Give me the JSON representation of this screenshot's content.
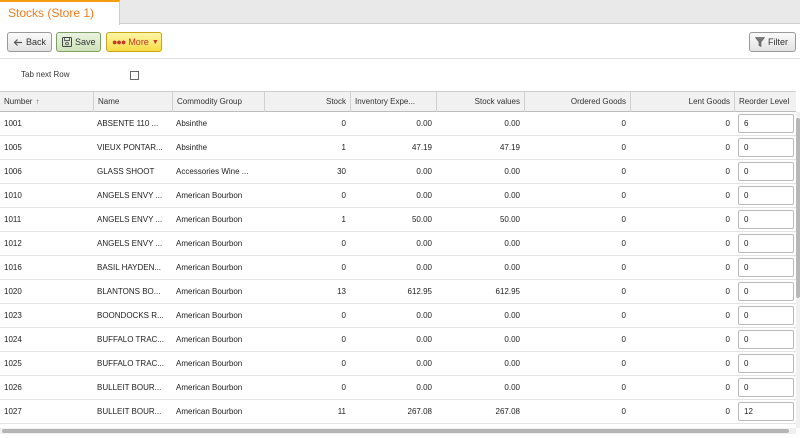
{
  "tab": {
    "title": "Stocks (Store 1)"
  },
  "toolbar": {
    "back_label": "Back",
    "save_label": "Save",
    "more_label": "More",
    "filter_label": "Filter"
  },
  "options": {
    "tab_next_row_label": "Tab next Row",
    "tab_next_row_checked": false
  },
  "table": {
    "columns": [
      "Number",
      "Name",
      "Commodity Group",
      "Stock",
      "Inventory Expe...",
      "Stock values",
      "Ordered Goods",
      "Lent Goods",
      "Reorder Level"
    ],
    "sorted_column": "Number",
    "rows": [
      {
        "number": "1001",
        "name": "ABSENTE 110 ...",
        "group": "Absinthe",
        "stock": "0",
        "inv": "0.00",
        "value": "0.00",
        "ordered": "0",
        "lent": "0",
        "reorder": "6"
      },
      {
        "number": "1005",
        "name": "VIEUX PONTAR...",
        "group": "Absinthe",
        "stock": "1",
        "inv": "47.19",
        "value": "47.19",
        "ordered": "0",
        "lent": "0",
        "reorder": "0"
      },
      {
        "number": "1006",
        "name": "GLASS SHOOT",
        "group": "Accessories Wine ...",
        "stock": "30",
        "inv": "0.00",
        "value": "0.00",
        "ordered": "0",
        "lent": "0",
        "reorder": "0"
      },
      {
        "number": "1010",
        "name": "ANGELS ENVY ...",
        "group": "American Bourbon",
        "stock": "0",
        "inv": "0.00",
        "value": "0.00",
        "ordered": "0",
        "lent": "0",
        "reorder": "0"
      },
      {
        "number": "1011",
        "name": "ANGELS ENVY ...",
        "group": "American Bourbon",
        "stock": "1",
        "inv": "50.00",
        "value": "50.00",
        "ordered": "0",
        "lent": "0",
        "reorder": "0"
      },
      {
        "number": "1012",
        "name": "ANGELS ENVY ...",
        "group": "American Bourbon",
        "stock": "0",
        "inv": "0.00",
        "value": "0.00",
        "ordered": "0",
        "lent": "0",
        "reorder": "0"
      },
      {
        "number": "1016",
        "name": "BASIL HAYDEN...",
        "group": "American Bourbon",
        "stock": "0",
        "inv": "0.00",
        "value": "0.00",
        "ordered": "0",
        "lent": "0",
        "reorder": "0"
      },
      {
        "number": "1020",
        "name": "BLANTONS BO...",
        "group": "American Bourbon",
        "stock": "13",
        "inv": "612.95",
        "value": "612.95",
        "ordered": "0",
        "lent": "0",
        "reorder": "0"
      },
      {
        "number": "1023",
        "name": "BOONDOCKS R...",
        "group": "American Bourbon",
        "stock": "0",
        "inv": "0.00",
        "value": "0.00",
        "ordered": "0",
        "lent": "0",
        "reorder": "0"
      },
      {
        "number": "1024",
        "name": "BUFFALO TRAC...",
        "group": "American Bourbon",
        "stock": "0",
        "inv": "0.00",
        "value": "0.00",
        "ordered": "0",
        "lent": "0",
        "reorder": "0"
      },
      {
        "number": "1025",
        "name": "BUFFALO TRAC...",
        "group": "American Bourbon",
        "stock": "0",
        "inv": "0.00",
        "value": "0.00",
        "ordered": "0",
        "lent": "0",
        "reorder": "0"
      },
      {
        "number": "1026",
        "name": "BULLEIT BOUR...",
        "group": "American Bourbon",
        "stock": "0",
        "inv": "0.00",
        "value": "0.00",
        "ordered": "0",
        "lent": "0",
        "reorder": "0"
      },
      {
        "number": "1027",
        "name": "BULLEIT BOUR...",
        "group": "American Bourbon",
        "stock": "11",
        "inv": "267.08",
        "value": "267.08",
        "ordered": "0",
        "lent": "0",
        "reorder": "12"
      }
    ]
  },
  "colors": {
    "accent": "#e67e22",
    "save_green": "#cfe3bb",
    "more_yellow": "#f7dc45"
  }
}
